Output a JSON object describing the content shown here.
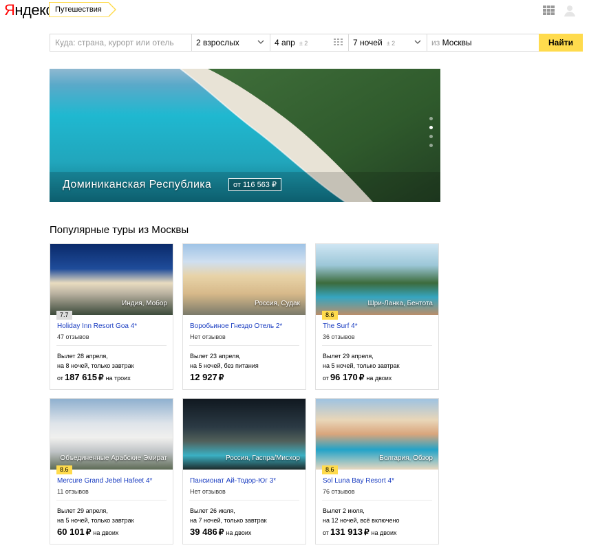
{
  "header": {
    "logo_first": "Я",
    "logo_rest": "ндекс",
    "service": "Путешествия"
  },
  "search": {
    "destination_placeholder": "Куда: страна, курорт или отель",
    "adults": "2 взрослых",
    "date": "4 апр",
    "date_flex": "± 2",
    "nights": "7 ночей",
    "nights_flex": "± 2",
    "origin_prefix": "из",
    "origin": "Москвы",
    "find_label": "Найти"
  },
  "hero": {
    "destination": "Доминиканская Республика",
    "price": "от 116 563 ₽",
    "slides_total": 4,
    "active_slide": 2
  },
  "section_title": "Популярные туры из Москвы",
  "colors": {
    "accent": "#ffdb4d",
    "link": "#1a3dc1",
    "logo_red": "#ff0000"
  },
  "cards": [
    {
      "location": "Индия, Мобор",
      "rating": "7.7",
      "rating_style": "gray",
      "name": "Holiday Inn Resort Goa 4*",
      "reviews": "47 отзывов",
      "dep_line1": "Вылет 28 апреля,",
      "dep_line2": "на 8 ночей, только завтрак",
      "price_prefix": "от",
      "price": "187 615",
      "currency": "₽",
      "price_suffix": "на троих"
    },
    {
      "location": "Россия, Судак",
      "rating": "",
      "rating_style": "none",
      "name": "Воробьиное Гнездо Отель 2*",
      "reviews": "Нет отзывов",
      "dep_line1": "Вылет 23 апреля,",
      "dep_line2": "на 5 ночей, без питания",
      "price_prefix": "",
      "price": "12 927",
      "currency": "₽",
      "price_suffix": ""
    },
    {
      "location": "Шри-Ланка, Бентота",
      "rating": "8.6",
      "rating_style": "yellow",
      "name": "The Surf 4*",
      "reviews": "36 отзывов",
      "dep_line1": "Вылет 29 апреля,",
      "dep_line2": "на 5 ночей, только завтрак",
      "price_prefix": "от",
      "price": "96 170",
      "currency": "₽",
      "price_suffix": "на двоих"
    },
    {
      "location": "Объединенные Арабские Эмират",
      "rating": "8.6",
      "rating_style": "yellow",
      "name": "Mercure Grand Jebel Hafeet 4*",
      "reviews": "11 отзывов",
      "dep_line1": "Вылет 29 апреля,",
      "dep_line2": "на 5 ночей, только завтрак",
      "price_prefix": "",
      "price": "60 101",
      "currency": "₽",
      "price_suffix": "на двоих"
    },
    {
      "location": "Россия, Гаспра/Мисхор",
      "rating": "",
      "rating_style": "none",
      "name": "Пансионат Ай-Тодор-Юг 3*",
      "reviews": "Нет отзывов",
      "dep_line1": "Вылет 26 июля,",
      "dep_line2": "на 7 ночей, только завтрак",
      "price_prefix": "",
      "price": "39 486",
      "currency": "₽",
      "price_suffix": "на двоих"
    },
    {
      "location": "Болгария, Обзор",
      "rating": "8.6",
      "rating_style": "yellow",
      "name": "Sol Luna Bay Resort 4*",
      "reviews": "76 отзывов",
      "dep_line1": "Вылет 2 июля,",
      "dep_line2": "на 12 ночей, всё включено",
      "price_prefix": "от",
      "price": "131 913",
      "currency": "₽",
      "price_suffix": "на двоих"
    }
  ]
}
